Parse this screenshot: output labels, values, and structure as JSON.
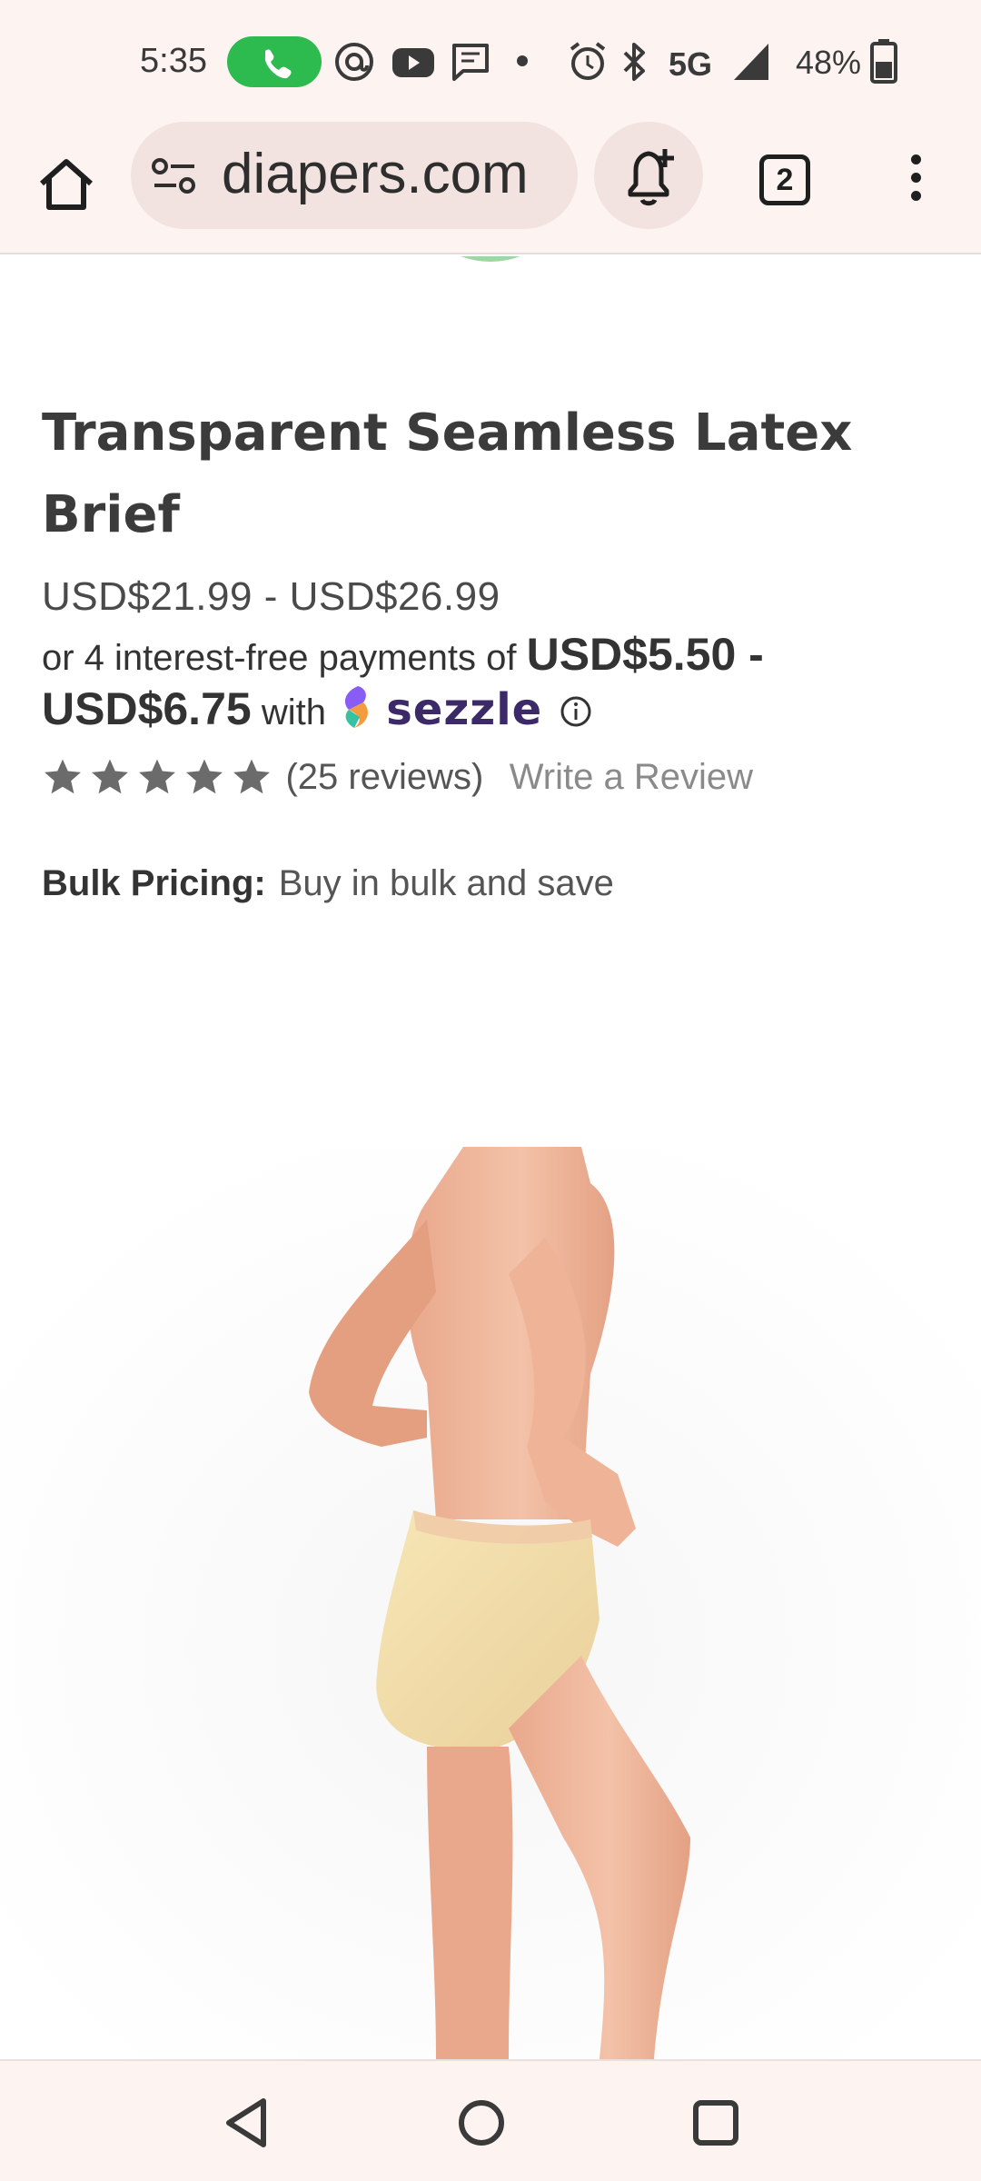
{
  "status_bar": {
    "time": "5:35",
    "network": "5G",
    "battery": "48%",
    "icons": [
      "call-icon",
      "threads-icon",
      "youtube-icon",
      "message-icon",
      "dot-icon",
      "alarm-icon",
      "bluetooth-icon",
      "signal-icon",
      "battery-icon"
    ]
  },
  "browser": {
    "url": "diapers.com",
    "tab_count": "2",
    "icons": [
      "home-icon",
      "site-settings-icon",
      "add-notification-icon",
      "tabs-icon",
      "more-menu-icon"
    ]
  },
  "product": {
    "title": "Transparent Seamless Latex Brief",
    "price_range": "USD$21.99 - USD$26.99",
    "installment_prefix": "or 4 interest-free payments of",
    "installment_amount": "USD$5.50 - USD$6.75",
    "installment_with": "with",
    "installment_provider": "sezzle",
    "rating_stars": 5,
    "reviews": "(25 reviews)",
    "write_review": "Write a Review",
    "bulk_label": "Bulk Pricing:",
    "bulk_text": "Buy in bulk and save"
  },
  "colors": {
    "status_bg": "#fdf4f2",
    "call_green": "#2dba4e",
    "star_gray": "#6b6b6b",
    "sezzle_purple": "#3c2a68"
  },
  "nav_bar": {
    "buttons": [
      "back-icon",
      "home-circle-icon",
      "recents-icon"
    ]
  }
}
